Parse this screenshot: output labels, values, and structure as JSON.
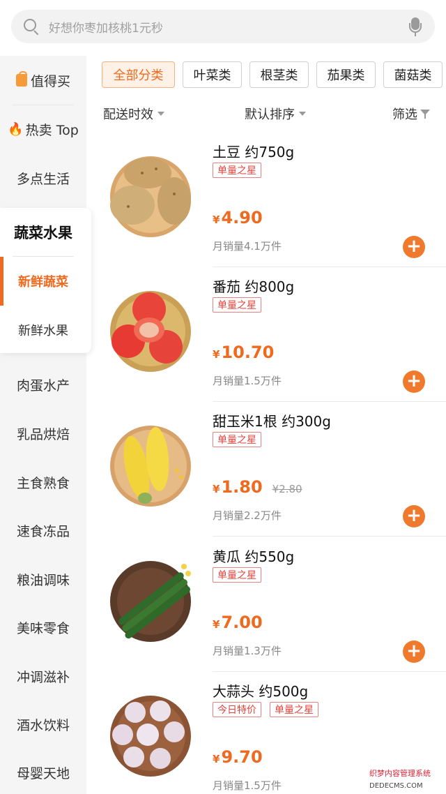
{
  "search": {
    "placeholder": "好想你枣加核桃1元秒"
  },
  "sidebar": {
    "items": [
      {
        "label": "值得买",
        "icon": "bag-icon"
      },
      {
        "label": "热卖 Top",
        "icon": "flame-icon"
      },
      {
        "label": "多点生活"
      }
    ],
    "group": {
      "title": "蔬菜水果",
      "subs": [
        "新鲜蔬菜",
        "新鲜水果"
      ],
      "active": "新鲜蔬菜"
    },
    "more": [
      "肉蛋水产",
      "乳品烘焙",
      "主食熟食",
      "速食冻品",
      "粮油调味",
      "美味零食",
      "冲调滋补",
      "酒水饮料",
      "母婴天地"
    ]
  },
  "chips": [
    "全部分类",
    "叶菜类",
    "根茎类",
    "茄果类",
    "菌菇类"
  ],
  "sort": {
    "delivery": "配送时效",
    "order": "默认排序",
    "filter": "筛选"
  },
  "currency": "¥",
  "products": [
    {
      "name": "土豆 约750g",
      "tags": [
        "单量之星"
      ],
      "price": "4.90",
      "old_price": "",
      "sales": "月销量4.1万件",
      "image": "potato"
    },
    {
      "name": "番茄 约800g",
      "tags": [
        "单量之星"
      ],
      "price": "10.70",
      "old_price": "",
      "sales": "月销量1.5万件",
      "image": "tomato"
    },
    {
      "name": "甜玉米1根 约300g",
      "tags": [
        "单量之星"
      ],
      "price": "1.80",
      "old_price": "¥2.80",
      "sales": "月销量2.2万件",
      "image": "corn"
    },
    {
      "name": "黄瓜 约550g",
      "tags": [
        "单量之星"
      ],
      "price": "7.00",
      "old_price": "",
      "sales": "月销量1.3万件",
      "image": "cucumber"
    },
    {
      "name": "大蒜头 约500g",
      "tags": [
        "今日特价",
        "单量之星"
      ],
      "price": "9.70",
      "old_price": "",
      "sales": "月销量1.5万件",
      "image": "garlic"
    }
  ],
  "watermark": {
    "line1": "织梦内容管理系统",
    "line2": "DEDECMS.COM"
  },
  "colors": {
    "accent": "#ef6a1f",
    "tag": "#e0433c"
  }
}
